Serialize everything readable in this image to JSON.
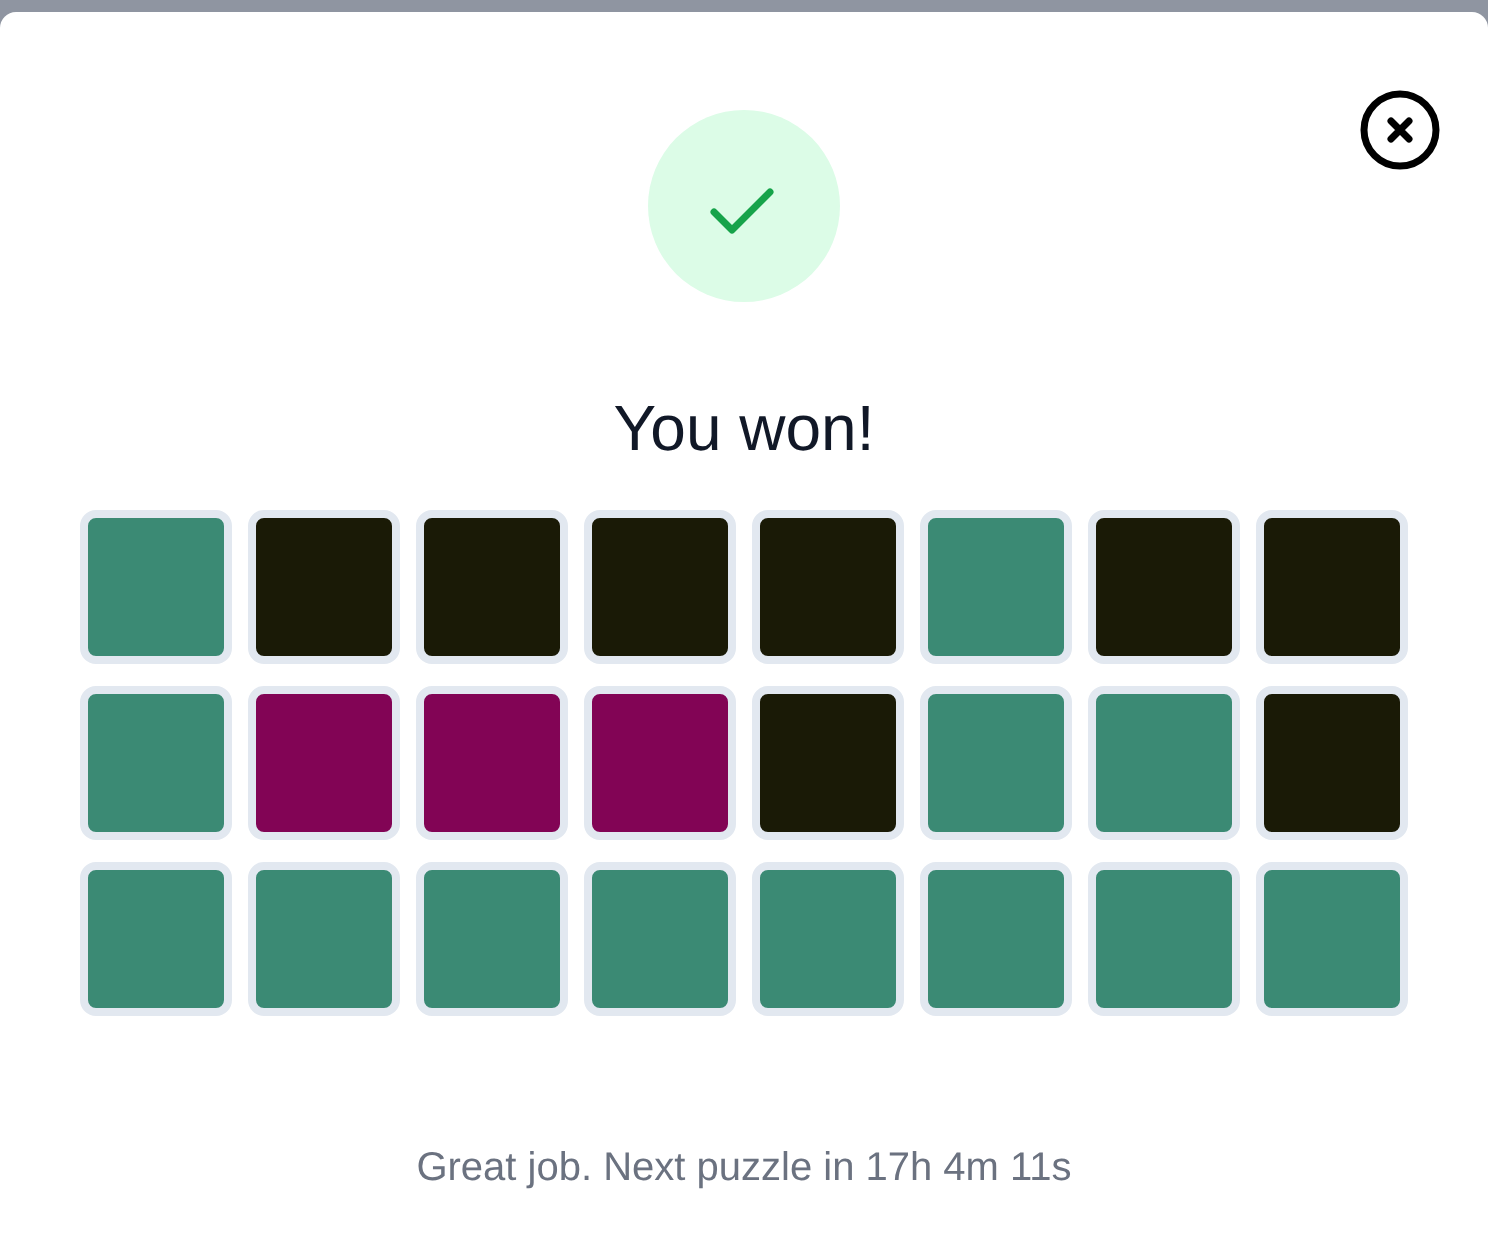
{
  "result": {
    "title": "You won!"
  },
  "grid": {
    "rows": [
      {
        "tiles": [
          {
            "color": "#3b8a74"
          },
          {
            "color": "#1a1a06"
          },
          {
            "color": "#1a1a06"
          },
          {
            "color": "#1a1a06"
          },
          {
            "color": "#1a1a06"
          },
          {
            "color": "#3b8a74"
          },
          {
            "color": "#1a1a06"
          },
          {
            "color": "#1a1a06"
          }
        ]
      },
      {
        "tiles": [
          {
            "color": "#3b8a74"
          },
          {
            "color": "#820455"
          },
          {
            "color": "#820455"
          },
          {
            "color": "#820455"
          },
          {
            "color": "#1a1a06"
          },
          {
            "color": "#3b8a74"
          },
          {
            "color": "#3b8a74"
          },
          {
            "color": "#1a1a06"
          }
        ]
      },
      {
        "tiles": [
          {
            "color": "#3b8a74"
          },
          {
            "color": "#3b8a74"
          },
          {
            "color": "#3b8a74"
          },
          {
            "color": "#3b8a74"
          },
          {
            "color": "#3b8a74"
          },
          {
            "color": "#3b8a74"
          },
          {
            "color": "#3b8a74"
          },
          {
            "color": "#3b8a74"
          }
        ]
      }
    ]
  },
  "footer": {
    "message": "Great job. Next puzzle in 17h 4m 11s"
  }
}
